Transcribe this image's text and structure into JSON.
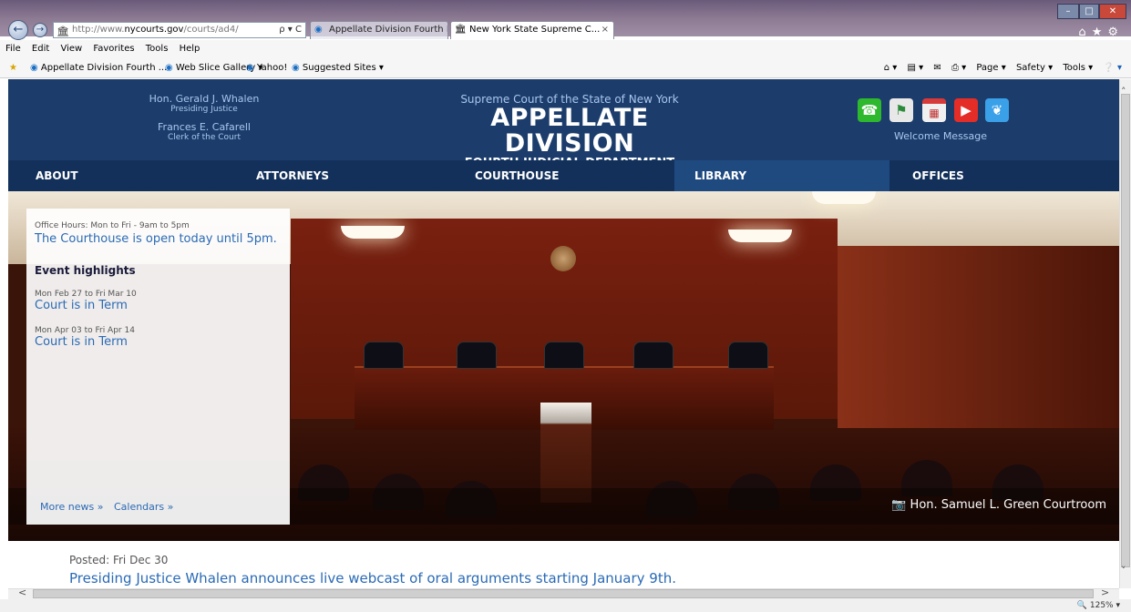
{
  "browser": {
    "address": {
      "prefix": "http://www.",
      "domain": "nycourts.gov",
      "path": "/courts/ad4/",
      "tools": "ρ ▾ C"
    },
    "tabs": [
      {
        "label": "Appellate Division Fourth Depa...",
        "active": false
      },
      {
        "label": "New York State Supreme C...",
        "active": true,
        "close": "×"
      }
    ],
    "menu": [
      "File",
      "Edit",
      "View",
      "Favorites",
      "Tools",
      "Help"
    ],
    "favorites": [
      "Appellate Division Fourth ...",
      "Web Slice Gallery ▾",
      "Yahoo!",
      "Suggested Sites ▾"
    ],
    "commands": [
      "Page ▾",
      "Safety ▾",
      "Tools ▾"
    ],
    "zoom": "125%"
  },
  "header": {
    "left": {
      "justice_name": "Hon. Gerald J. Whalen",
      "justice_title": "Presiding Justice",
      "clerk_name": "Frances E. Cafarell",
      "clerk_title": "Clerk of the Court"
    },
    "center": {
      "super": "Supreme Court of the State of New York",
      "title": "APPELLATE DIVISION",
      "subtitle": "FOURTH JUDICIAL DEPARTMENT"
    },
    "welcome": "Welcome Message",
    "social_icons": [
      "phone-icon",
      "maps-icon",
      "calendar-icon",
      "youtube-icon",
      "twitter-icon"
    ]
  },
  "nav": [
    "ABOUT",
    "ATTORNEYS",
    "COURTHOUSE",
    "LIBRARY",
    "OFFICES"
  ],
  "panel": {
    "office_hours": "Office Hours: Mon to Fri - 9am to 5pm",
    "open_status": "The Courthouse is open today until 5pm.",
    "events_heading": "Event highlights",
    "events": [
      {
        "dates": "Mon Feb 27 to Fri Mar 10",
        "title": "Court is in Term"
      },
      {
        "dates": "Mon Apr 03 to Fri Apr 14",
        "title": "Court is in Term"
      }
    ],
    "more_news": "More news »",
    "calendars": "Calendars »"
  },
  "hero": {
    "caption": "Hon. Samuel L. Green Courtroom"
  },
  "news": {
    "posted": "Posted: Fri Dec 30",
    "headline": "Presiding Justice Whalen announces live webcast of oral arguments starting January 9th."
  },
  "colors": {
    "header_bg": "#1c3d6b",
    "nav_bg": "#12305a",
    "link": "#2a6ab5"
  }
}
